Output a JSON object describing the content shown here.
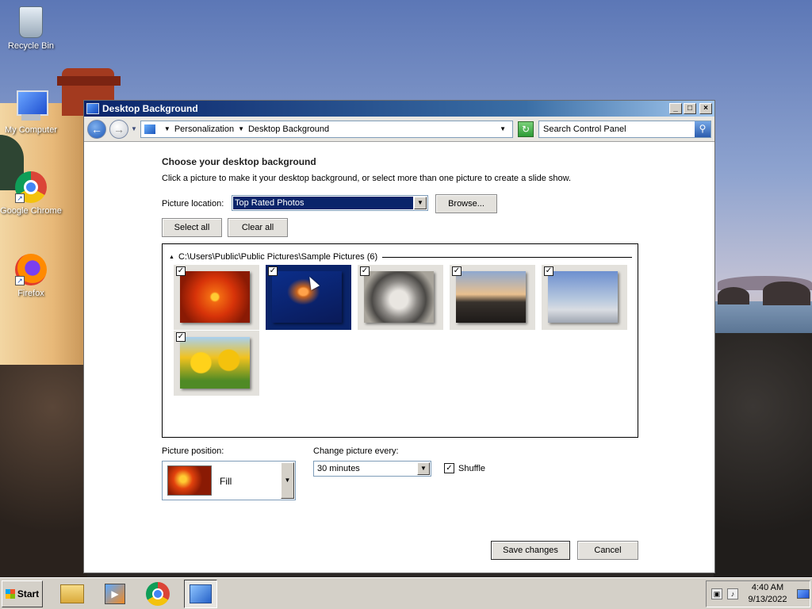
{
  "desktop": {
    "icons": [
      {
        "label": "Recycle Bin",
        "icon": "recycle-bin-icon"
      },
      {
        "label": "My Computer",
        "icon": "computer-icon"
      },
      {
        "label": "Google Chrome",
        "icon": "chrome-icon"
      },
      {
        "label": "Firefox",
        "icon": "firefox-icon"
      }
    ]
  },
  "window": {
    "title": "Desktop Background",
    "controls": {
      "minimize": "_",
      "maximize": "□",
      "close": "×"
    },
    "address": {
      "crumbs": [
        "Personalization",
        "Desktop Background"
      ]
    },
    "search_placeholder": "Search Control Panel",
    "content": {
      "heading": "Choose your desktop background",
      "subtext": "Click a picture to make it your desktop background, or select more than one picture to create a slide show.",
      "picture_location_label": "Picture location:",
      "picture_location_value": "Top Rated Photos",
      "browse_label": "Browse...",
      "select_all_label": "Select all",
      "clear_all_label": "Clear all",
      "group_title": "C:\\Users\\Public\\Public Pictures\\Sample Pictures (6)",
      "pictures": [
        {
          "name": "flower",
          "checked": true,
          "selected": false
        },
        {
          "name": "jellyfish",
          "checked": true,
          "selected": true
        },
        {
          "name": "koala",
          "checked": true,
          "selected": false
        },
        {
          "name": "lighthouse",
          "checked": true,
          "selected": false
        },
        {
          "name": "penguins",
          "checked": true,
          "selected": false
        },
        {
          "name": "tulips",
          "checked": true,
          "selected": false
        }
      ],
      "picture_position_label": "Picture position:",
      "picture_position_value": "Fill",
      "change_every_label": "Change picture every:",
      "change_every_value": "30 minutes",
      "shuffle_label": "Shuffle",
      "shuffle_checked": true,
      "save_label": "Save changes",
      "cancel_label": "Cancel"
    }
  },
  "taskbar": {
    "start_label": "Start",
    "items": [
      "folder-icon",
      "media-player-icon",
      "chrome-icon",
      "control-panel-icon"
    ],
    "clock": {
      "time": "4:40 AM",
      "date": "9/13/2022"
    }
  },
  "colors": {
    "selection": "#0a246a",
    "titlebar": "#0a246a",
    "window_face": "#d4d0c8"
  }
}
